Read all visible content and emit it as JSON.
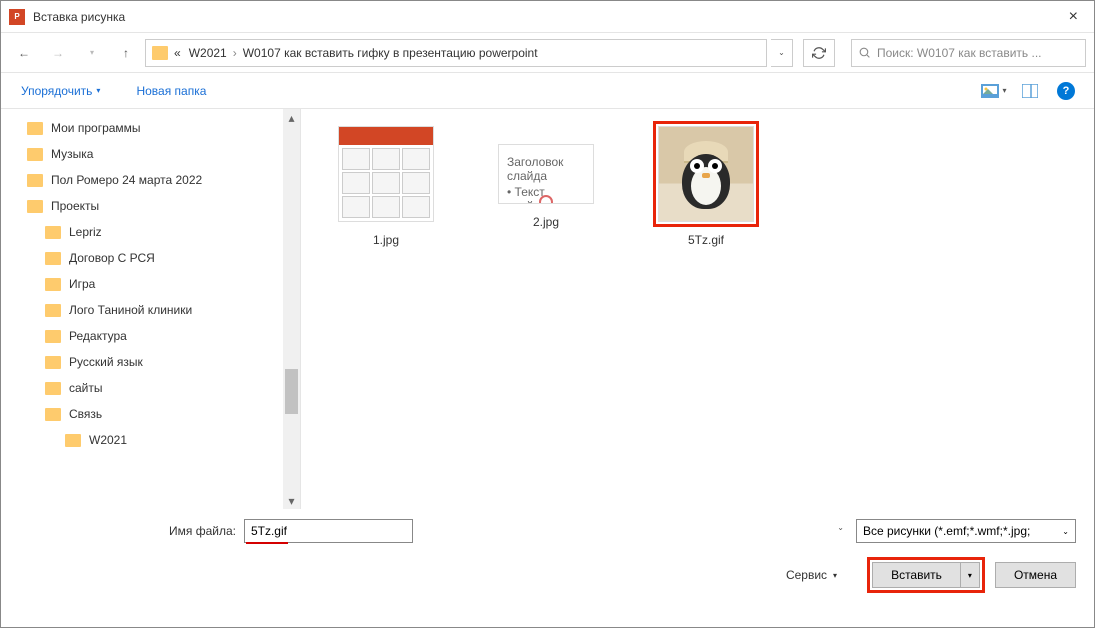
{
  "titlebar": {
    "title": "Вставка рисунка"
  },
  "nav": {
    "crumb_prefix": "«",
    "crumb1": "W2021",
    "crumb2": "W0107 как вставить гифку в презентацию powerpoint"
  },
  "search": {
    "placeholder": "Поиск: W0107 как вставить ..."
  },
  "toolbar": {
    "organize": "Упорядочить",
    "newfolder": "Новая папка"
  },
  "tree": {
    "items": [
      {
        "label": "Мои программы",
        "indent": 0
      },
      {
        "label": "Музыка",
        "indent": 0
      },
      {
        "label": "Пол Ромеро 24 марта 2022",
        "indent": 0
      },
      {
        "label": "Проекты",
        "indent": 0
      },
      {
        "label": "Lepriz",
        "indent": 1
      },
      {
        "label": "Договор С РСЯ",
        "indent": 1
      },
      {
        "label": "Игра",
        "indent": 1
      },
      {
        "label": "Лого Таниной клиники",
        "indent": 1
      },
      {
        "label": "Редактура",
        "indent": 1
      },
      {
        "label": "Русский язык",
        "indent": 1
      },
      {
        "label": "сайты",
        "indent": 1
      },
      {
        "label": "Связь",
        "indent": 1
      },
      {
        "label": "W2021",
        "indent": 2
      }
    ]
  },
  "files": {
    "f1": "1.jpg",
    "f2": "2.jpg",
    "f3": "5Tz.gif"
  },
  "footer": {
    "filename_label": "Имя файла:",
    "filename_value": "5Tz.gif",
    "filetype": "Все рисунки (*.emf;*.wmf;*.jpg;",
    "service": "Сервис",
    "insert": "Вставить",
    "cancel": "Отмена"
  }
}
